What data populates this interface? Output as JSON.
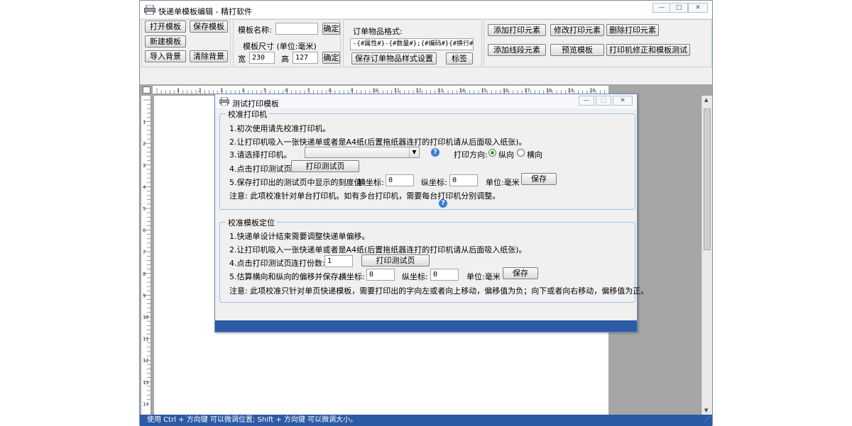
{
  "window": {
    "title": "快递单模板编辑 - 精打软件"
  },
  "toolbar": {
    "open_template": "打开模板",
    "save_template": "保存模板",
    "new_template": "新建模板",
    "import_bg": "导入背景",
    "clear_bg": "清除背景",
    "template_name_label": "模板名称:",
    "confirm": "确定",
    "template_size_label": "模板尺寸 (单位:毫米)",
    "width_label": "宽",
    "width_value": "230",
    "height_label": "高",
    "height_value": "127",
    "order_format_label": "订单物品格式:",
    "order_format_value": "-{#属性#}-{#数量#};{#编码#}{#换行#}",
    "save_format": "保存订单物品样式设置",
    "tag": "标签",
    "add_print_element": "添加打印元素",
    "edit_print_element": "修改打印元素",
    "delete_print_element": "删除打印元素",
    "add_line_element": "添加线段元素",
    "preview_template": "预览模板",
    "calibrate_test": "打印机修正和模板测试"
  },
  "ruler": {
    "top_marks": [
      "1",
      "2",
      "3",
      "4",
      "5",
      "6",
      "7",
      "8",
      "9",
      "10",
      "11",
      "12",
      "13",
      "14",
      "15",
      "16",
      "17",
      "18",
      "19",
      "20",
      "2"
    ],
    "left_marks": [
      "1",
      "2",
      "3",
      "4",
      "5",
      "6",
      "7",
      "8",
      "9",
      "10",
      "11",
      "12",
      "13",
      "14"
    ]
  },
  "statusbar": {
    "text": "使用 Ctrl + 方向键 可以微调位置; Shift + 方向键 可以微调大小。"
  },
  "dialog": {
    "title": "测试打印模板",
    "group1": {
      "title": "校准打印机",
      "step1": "1.初次使用请先校准打印机。",
      "step2": "2.让打印机吸入一张快递单或者是A4纸(后置拖纸器连打的打印机请从后面吸入纸张)。",
      "step3": "3.请选择打印机。",
      "printer_selected": "",
      "direction_label": "打印方向:",
      "portrait": "纵向",
      "landscape": "横向",
      "step4": "4.点击打印测试页。",
      "print_test_page": "打印测试页",
      "step5": "5.保存打印出的测试页中显示的刻度值",
      "x_label": "横坐标:",
      "x_value": "0",
      "y_label": "纵坐标:",
      "y_value": "0",
      "unit": "单位:毫米",
      "save": "保存",
      "note": "注意: 此项校准针对单台打印机。如有多台打印机，需要每台打印机分别调整。"
    },
    "group2": {
      "title": "校准模板定位",
      "step1": "1.快递单设计结束需要调整快递单偏移。",
      "step2": "2.让打印机吸入一张快递单或者是A4纸(后置拖纸器连打的打印机请从后面吸入纸张)。",
      "step4": "4.点击打印测试页",
      "copies_label": "连打份数:",
      "copies_value": "1",
      "print_test_page": "打印测试页",
      "step5": "5.估算横向和纵向的偏移并保存。",
      "x_label": "横坐标:",
      "x_value": "0",
      "y_label": "纵坐标:",
      "y_value": "0",
      "unit": "单位:毫米",
      "save": "保存",
      "note": "注意: 此项校准只针对单页快递模板，需要打印出的字向左或者向上移动，偏移值为负；向下或者向右移动，偏移值为正。"
    }
  },
  "colors": {
    "accent": "#2d5aa5",
    "group_border": "#9ec1e6",
    "radio_on": "#2a9a2a"
  }
}
